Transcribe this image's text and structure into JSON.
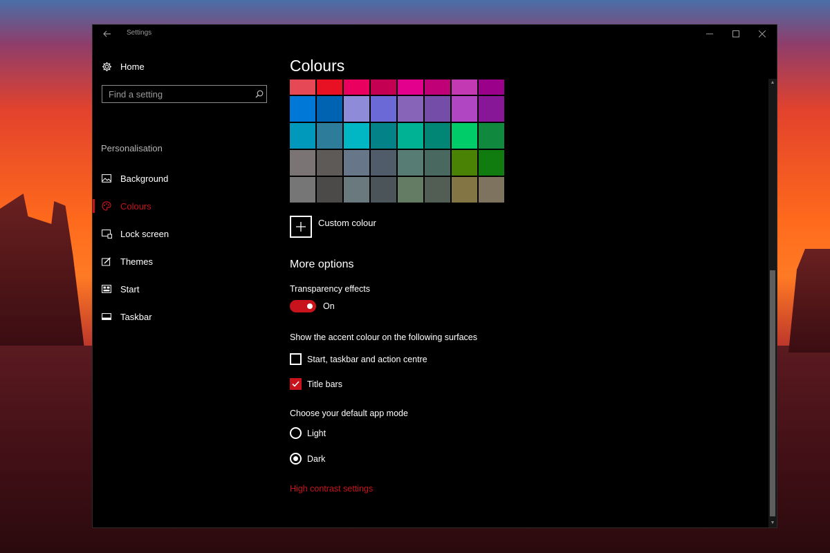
{
  "window": {
    "title": "Settings",
    "back_icon": "back-arrow-icon",
    "controls": [
      "minimize-icon",
      "maximize-icon",
      "close-icon"
    ]
  },
  "sidebar": {
    "home_label": "Home",
    "search_placeholder": "Find a setting",
    "section_label": "Personalisation",
    "items": [
      {
        "label": "Background",
        "icon": "image-icon"
      },
      {
        "label": "Colours",
        "icon": "palette-icon",
        "active": true
      },
      {
        "label": "Lock screen",
        "icon": "lock-screen-icon"
      },
      {
        "label": "Themes",
        "icon": "themes-icon"
      },
      {
        "label": "Start",
        "icon": "start-icon"
      },
      {
        "label": "Taskbar",
        "icon": "taskbar-icon"
      }
    ]
  },
  "main": {
    "title": "Colours",
    "swatches": [
      "#E74856",
      "#E81123",
      "#EA005E",
      "#C30052",
      "#E3008C",
      "#BF0077",
      "#C239B3",
      "#9A0089",
      "#0078D7",
      "#0063B1",
      "#8E8CD8",
      "#6B69D6",
      "#8764B8",
      "#744DA9",
      "#B146C2",
      "#881798",
      "#0099BC",
      "#2D7D9A",
      "#00B7C3",
      "#038387",
      "#00B294",
      "#018574",
      "#00CC6A",
      "#10893E",
      "#7A7574",
      "#5D5A58",
      "#68768A",
      "#515C6B",
      "#567C73",
      "#486860",
      "#498205",
      "#107C10",
      "#767676",
      "#4C4A48",
      "#69797E",
      "#4A5459",
      "#647C64",
      "#525E54",
      "#847545",
      "#7E735F"
    ],
    "custom_colour_label": "Custom colour",
    "more_options_heading": "More options",
    "transparency_label": "Transparency effects",
    "transparency_state": "On",
    "accent_surfaces_label": "Show the accent colour on the following surfaces",
    "checkbox_start_label": "Start, taskbar and action centre",
    "checkbox_title_bars_label": "Title bars",
    "app_mode_label": "Choose your default app mode",
    "radio_light_label": "Light",
    "radio_dark_label": "Dark",
    "high_contrast_link": "High contrast settings"
  },
  "accent_color": "#C8131C"
}
